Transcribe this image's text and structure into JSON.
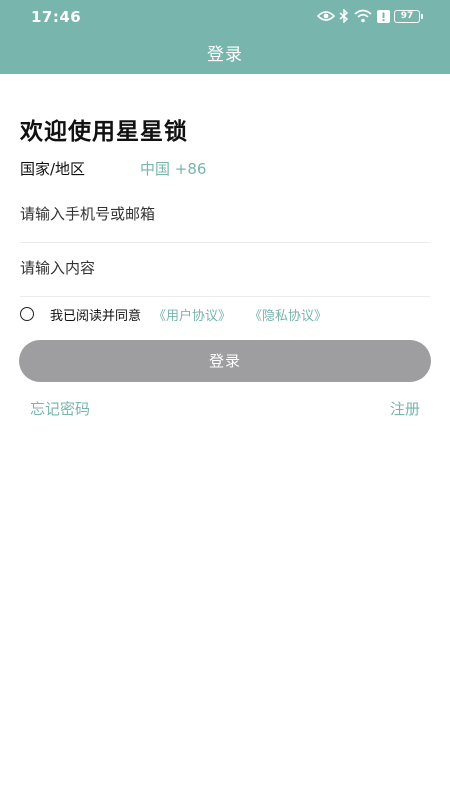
{
  "status_bar": {
    "time": "17:46",
    "battery": "97",
    "icons": [
      "eye-icon",
      "bluetooth-icon",
      "wifi-icon",
      "alert-icon",
      "battery-icon"
    ]
  },
  "header": {
    "title": "登录"
  },
  "main": {
    "welcome": "欢迎使用星星锁",
    "region_label": "国家/地区",
    "region_value": "中国 +86",
    "account_placeholder": "请输入手机号或邮箱",
    "password_placeholder": "请输入内容",
    "agree_text": "我已阅读并同意",
    "user_agreement": "《用户协议》",
    "privacy_policy": "《隐私协议》",
    "login_button": "登录",
    "forgot_password": "忘记密码",
    "register": "注册"
  },
  "colors": {
    "accent": "#78b5ac",
    "button_disabled": "#9e9ea0"
  }
}
